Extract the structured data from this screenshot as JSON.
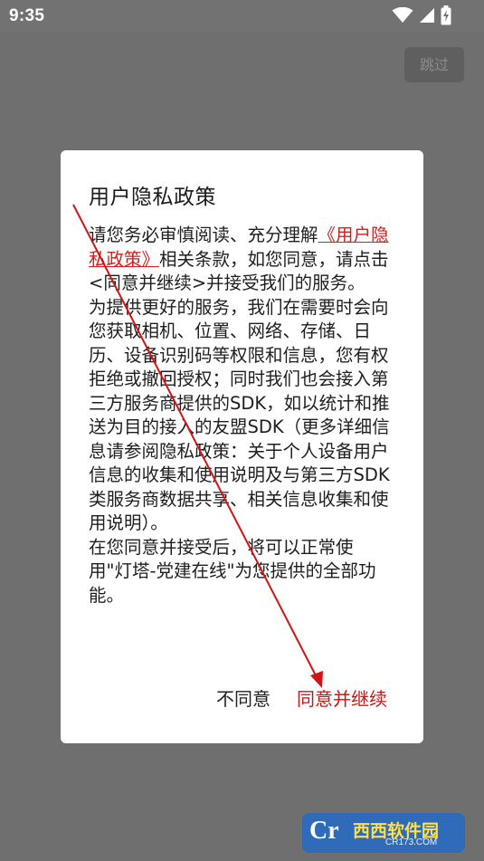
{
  "status_bar": {
    "time": "9:35",
    "icons": [
      "wifi-icon",
      "signal-icon",
      "battery-charging-icon"
    ]
  },
  "skip_button": {
    "label": "跳过"
  },
  "dialog": {
    "title": "用户隐私政策",
    "body": {
      "intro_text": "请您务必审慎阅读、充分理解",
      "policy_link": "《用户隐私政策》",
      "intro_after_link": "相关条款，如您同意，请点击<同意并继续>并接受我们的服务。",
      "paragraph_2": "为提供更好的服务，我们在需要时会向您获取相机、位置、网络、存储、日历、设备识别码等权限和信息，您有权拒绝或撤回授权；同时我们也会接入第三方服务商提供的SDK，如以统计和推送为目的接入的友盟SDK（更多详细信息请参阅隐私政策：关于个人设备用户信息的收集和使用说明及与第三方SDK类服务商数据共享、相关信息收集和使用说明）。",
      "paragraph_3": "在您同意并接受后，将可以正常使用\"灯塔-党建在线\"为您提供的全部功能。"
    },
    "actions": {
      "disagree_label": "不同意",
      "agree_label": "同意并继续"
    }
  },
  "watermark": {
    "mark": "Cr",
    "name": "西西软件园",
    "domain": "CR173.COM"
  },
  "colors": {
    "overlay": "#6f6f6f",
    "accent_red": "#cc1414",
    "dialog_bg": "#ffffff"
  }
}
